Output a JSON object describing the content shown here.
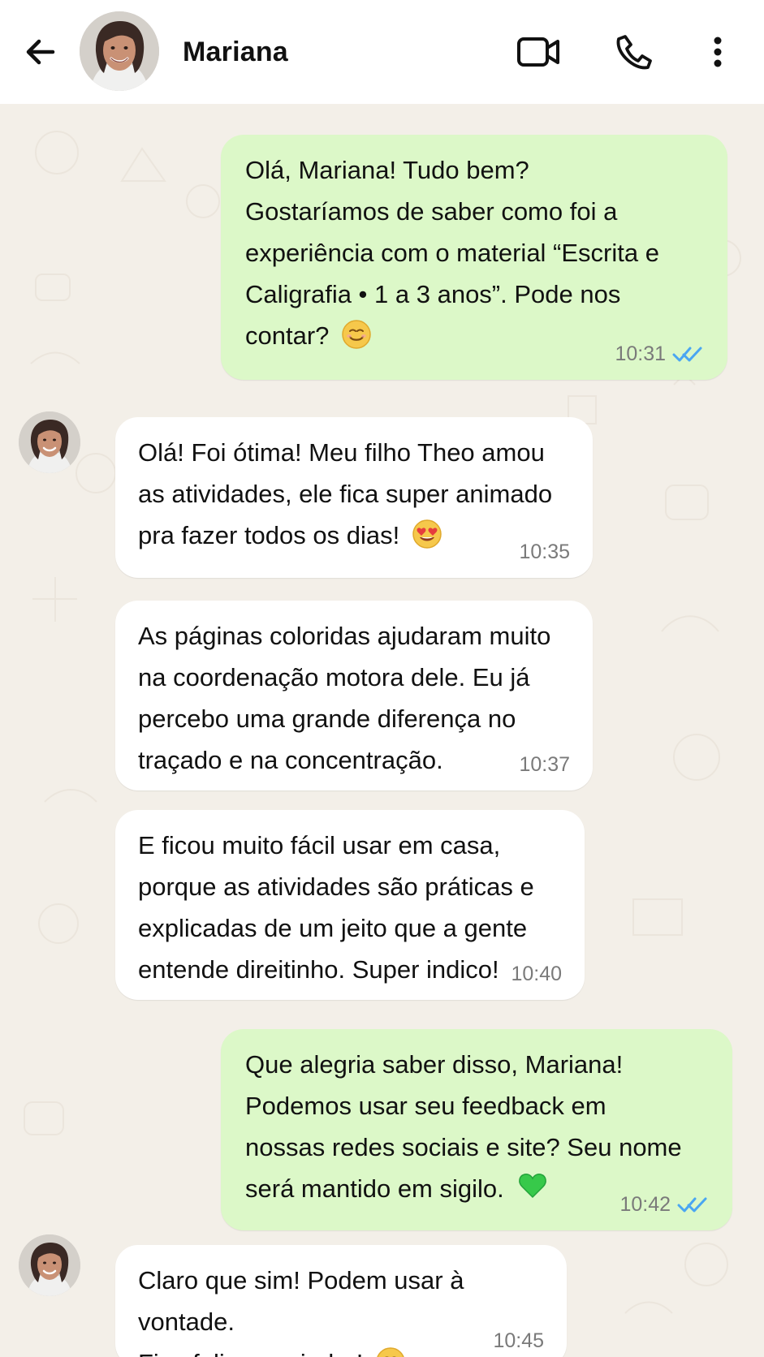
{
  "header": {
    "contact_name": "Mariana",
    "icons": {
      "back": "back-arrow-icon",
      "video": "video-call-icon",
      "call": "phone-call-icon",
      "menu": "more-options-icon"
    }
  },
  "colors": {
    "header_bg": "#ffffff",
    "chat_bg": "#f3efe8",
    "sent_bubble": "#dcf8c8",
    "received_bubble": "#ffffff",
    "read_tick": "#4aa6f2",
    "heart_green": "#37c94a"
  },
  "messages": [
    {
      "direction": "sent",
      "text": "Olá, Mariana! Tudo bem?\nGostaríamos de saber como foi a\nexperiência com o material “Escrita e\nCaligrafia • 1 a 3 anos”. Pode nos\ncontar?",
      "emoji": "smile-emoji-icon",
      "time": "10:31",
      "status": "read"
    },
    {
      "direction": "received",
      "text": "Olá! Foi ótima! Meu filho Theo amou\nas atividades, ele fica super animado\npra fazer todos os dias!",
      "emoji": "heart-eyes-emoji-icon",
      "time": "10:35"
    },
    {
      "direction": "received",
      "text": "As páginas coloridas ajudaram muito\nna coordenação motora dele. Eu já\npercebo uma grande diferença no\ntraçado e na concentração.",
      "time": "10:37"
    },
    {
      "direction": "received",
      "text": "E ficou muito fácil usar em casa,\nporque as atividades são práticas e\nexplicadas de um jeito que a gente\nentende direitinho. Super indico!",
      "time": "10:40"
    },
    {
      "direction": "sent",
      "text": "Que alegria saber disso, Mariana!\nPodemos usar seu feedback em\nnossas redes sociais e site? Seu nome\nserá mantido em sigilo.",
      "emoji": "green-heart-icon",
      "time": "10:42",
      "status": "read"
    },
    {
      "direction": "received",
      "text": "Claro que sim! Podem usar à vontade.\nFico feliz em ajudar!",
      "emoji": "smile-emoji-icon",
      "time": "10:45"
    }
  ]
}
